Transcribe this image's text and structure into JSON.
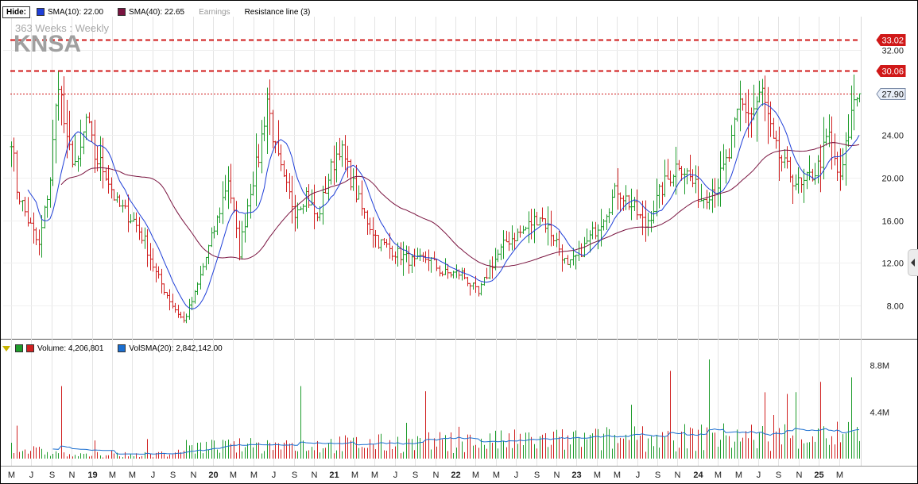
{
  "legend": {
    "hide_label": "Hide:",
    "items": [
      {
        "label": "SMA(10): 22.00",
        "color": "#1f3fd8"
      },
      {
        "label": "SMA(40): 22.65",
        "color": "#7a1440"
      },
      {
        "label": "Earnings",
        "color": ""
      },
      {
        "label": "Resistance line (3)",
        "color": ""
      }
    ]
  },
  "chart_header": {
    "period": "363  Weeks : Weekly",
    "ticker": "KNSA"
  },
  "volume_legend": {
    "label": "Volume: 4,206,801",
    "volsma_label": "VolSMA(20): 2,842,142.00",
    "up_color": "#1e9c2c",
    "down_color": "#d02020",
    "volsma_color": "#1a6ed0"
  },
  "chart_data": {
    "type": "ohlc-weekly-with-volume",
    "y_ticks": [
      "32.00",
      "24.00",
      "20.00",
      "16.00",
      "12.00",
      "8.00"
    ],
    "y_tick_values": [
      32,
      24,
      20,
      16,
      12,
      8
    ],
    "price_range": [
      5,
      35
    ],
    "resistance_lines": [
      {
        "value": 33.02,
        "label": "33.02",
        "color": "#d01818"
      },
      {
        "value": 30.06,
        "label": "30.06",
        "color": "#d01818"
      },
      {
        "value": 27.9,
        "label": "27.90",
        "color": "#d01818"
      }
    ],
    "last_price_label": "27.90",
    "volume_ticks": [
      "8.8M",
      "4.4M"
    ],
    "volume_tick_values": [
      8.8,
      4.4
    ],
    "volume_range_millions": [
      0,
      9.6
    ],
    "x_labels": [
      "M",
      "J",
      "S",
      "N",
      "19",
      "M",
      "M",
      "J",
      "S",
      "N",
      "20",
      "M",
      "M",
      "J",
      "S",
      "N",
      "21",
      "M",
      "M",
      "J",
      "S",
      "N",
      "22",
      "M",
      "M",
      "J",
      "S",
      "N",
      "23",
      "M",
      "M",
      "J",
      "S",
      "N",
      "24",
      "M",
      "M",
      "J",
      "S",
      "N",
      "25",
      "M"
    ],
    "price_keypoints": [
      [
        0,
        24
      ],
      [
        2,
        19
      ],
      [
        6,
        16
      ],
      [
        10,
        13.5
      ],
      [
        14,
        20
      ],
      [
        17,
        29.5
      ],
      [
        20,
        23
      ],
      [
        24,
        21
      ],
      [
        27,
        25.5
      ],
      [
        30,
        22
      ],
      [
        34,
        20.5
      ],
      [
        38,
        17.5
      ],
      [
        44,
        16
      ],
      [
        48,
        14
      ],
      [
        52,
        11
      ],
      [
        58,
        8
      ],
      [
        62,
        6.5
      ],
      [
        66,
        9
      ],
      [
        70,
        12.5
      ],
      [
        74,
        16
      ],
      [
        78,
        20
      ],
      [
        82,
        13
      ],
      [
        86,
        19
      ],
      [
        89,
        22
      ],
      [
        92,
        27.5
      ],
      [
        95,
        22.5
      ],
      [
        98,
        19.5
      ],
      [
        102,
        17
      ],
      [
        106,
        18.5
      ],
      [
        110,
        16
      ],
      [
        114,
        20
      ],
      [
        118,
        23
      ],
      [
        122,
        20
      ],
      [
        126,
        17
      ],
      [
        132,
        14
      ],
      [
        138,
        13
      ],
      [
        145,
        12
      ],
      [
        150,
        12.5
      ],
      [
        155,
        11
      ],
      [
        162,
        11
      ],
      [
        168,
        9
      ],
      [
        172,
        11.5
      ],
      [
        178,
        14
      ],
      [
        184,
        15
      ],
      [
        190,
        16.5
      ],
      [
        196,
        14
      ],
      [
        200,
        11.5
      ],
      [
        206,
        13.5
      ],
      [
        212,
        16
      ],
      [
        218,
        19
      ],
      [
        224,
        17
      ],
      [
        228,
        15.5
      ],
      [
        234,
        19
      ],
      [
        240,
        21.5
      ],
      [
        244,
        20
      ],
      [
        248,
        18
      ],
      [
        254,
        19.5
      ],
      [
        258,
        22
      ],
      [
        262,
        27
      ],
      [
        266,
        26
      ],
      [
        270,
        28
      ],
      [
        274,
        23
      ],
      [
        278,
        21
      ],
      [
        284,
        19
      ],
      [
        290,
        21
      ],
      [
        294,
        24
      ],
      [
        298,
        19.5
      ],
      [
        303,
        27.5
      ],
      [
        305,
        27.9
      ]
    ]
  }
}
